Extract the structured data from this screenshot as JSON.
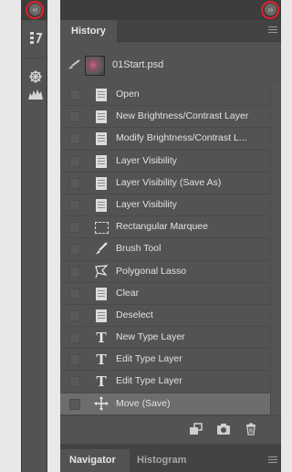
{
  "tool_strip": {
    "collapse_glyph": "‹‹",
    "icons": [
      "history-panel-icon",
      "color-wheel-icon",
      "histogram-icon"
    ]
  },
  "panel": {
    "collapse_glyph": "››",
    "tab": "History",
    "snapshot": {
      "label": "01Start.psd"
    },
    "history": [
      {
        "label": "Open",
        "icon": "doc"
      },
      {
        "label": "New Brightness/Contrast Layer",
        "icon": "doc"
      },
      {
        "label": "Modify Brightness/Contrast L...",
        "icon": "doc"
      },
      {
        "label": "Layer Visibility",
        "icon": "doc"
      },
      {
        "label": "Layer Visibility (Save As)",
        "icon": "doc"
      },
      {
        "label": "Layer Visibility",
        "icon": "doc"
      },
      {
        "label": "Rectangular Marquee",
        "icon": "marquee"
      },
      {
        "label": "Brush Tool",
        "icon": "brush"
      },
      {
        "label": "Polygonal Lasso",
        "icon": "lasso"
      },
      {
        "label": "Clear",
        "icon": "doc"
      },
      {
        "label": "Deselect",
        "icon": "doc"
      },
      {
        "label": "New Type Layer",
        "icon": "type"
      },
      {
        "label": "Edit Type Layer",
        "icon": "type"
      },
      {
        "label": "Edit Type Layer",
        "icon": "type"
      },
      {
        "label": "Move (Save)",
        "icon": "move",
        "selected": true
      }
    ],
    "footer_icons": [
      "new-document-from-state-icon",
      "camera-snapshot-icon",
      "trash-icon"
    ],
    "bottom_tabs": {
      "active": "Navigator",
      "other": "Histogram"
    }
  },
  "colors": {
    "highlight_ring": "#e0222b",
    "panel_bg": "#535353",
    "selected_row": "#6d6d6d"
  }
}
